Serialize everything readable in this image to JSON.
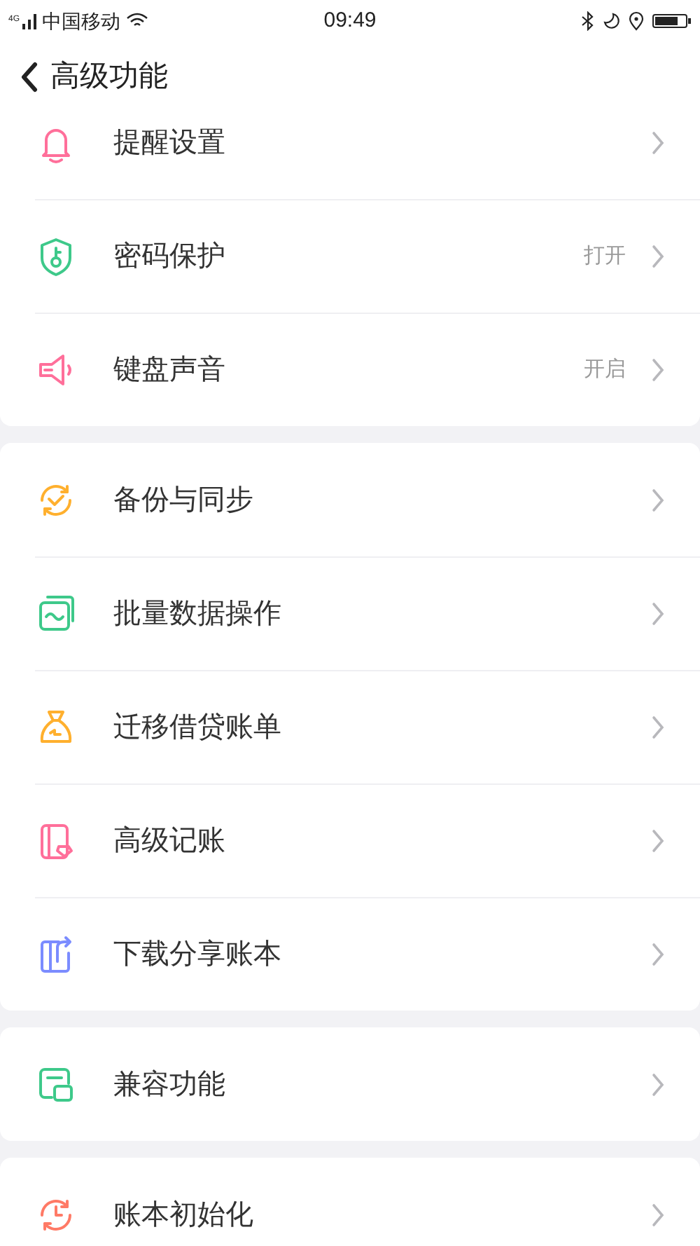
{
  "status_bar": {
    "network": "4G",
    "carrier": "中国移动",
    "time": "09:49"
  },
  "header": {
    "title": "高级功能"
  },
  "groups": [
    {
      "items": [
        {
          "kind": "bell",
          "color": "#ff6f9a",
          "label": "提醒设置"
        },
        {
          "kind": "shield",
          "color": "#3ec98a",
          "label": "密码保护",
          "value": "打开"
        },
        {
          "kind": "speaker",
          "color": "#ff6f9a",
          "label": "键盘声音",
          "value": "开启"
        }
      ]
    },
    {
      "items": [
        {
          "kind": "sync",
          "color": "#ffb02e",
          "label": "备份与同步"
        },
        {
          "kind": "wave",
          "color": "#3ec98a",
          "label": "批量数据操作"
        },
        {
          "kind": "bag",
          "color": "#ffb02e",
          "label": "迁移借贷账单"
        },
        {
          "kind": "book",
          "color": "#ff6f9a",
          "label": "高级记账"
        },
        {
          "kind": "share",
          "color": "#7b8cff",
          "label": "下载分享账本"
        }
      ]
    },
    {
      "items": [
        {
          "kind": "window",
          "color": "#3ec98a",
          "label": "兼容功能"
        }
      ]
    },
    {
      "items": [
        {
          "kind": "clock",
          "color": "#ff7a66",
          "label": "账本初始化"
        }
      ]
    }
  ]
}
